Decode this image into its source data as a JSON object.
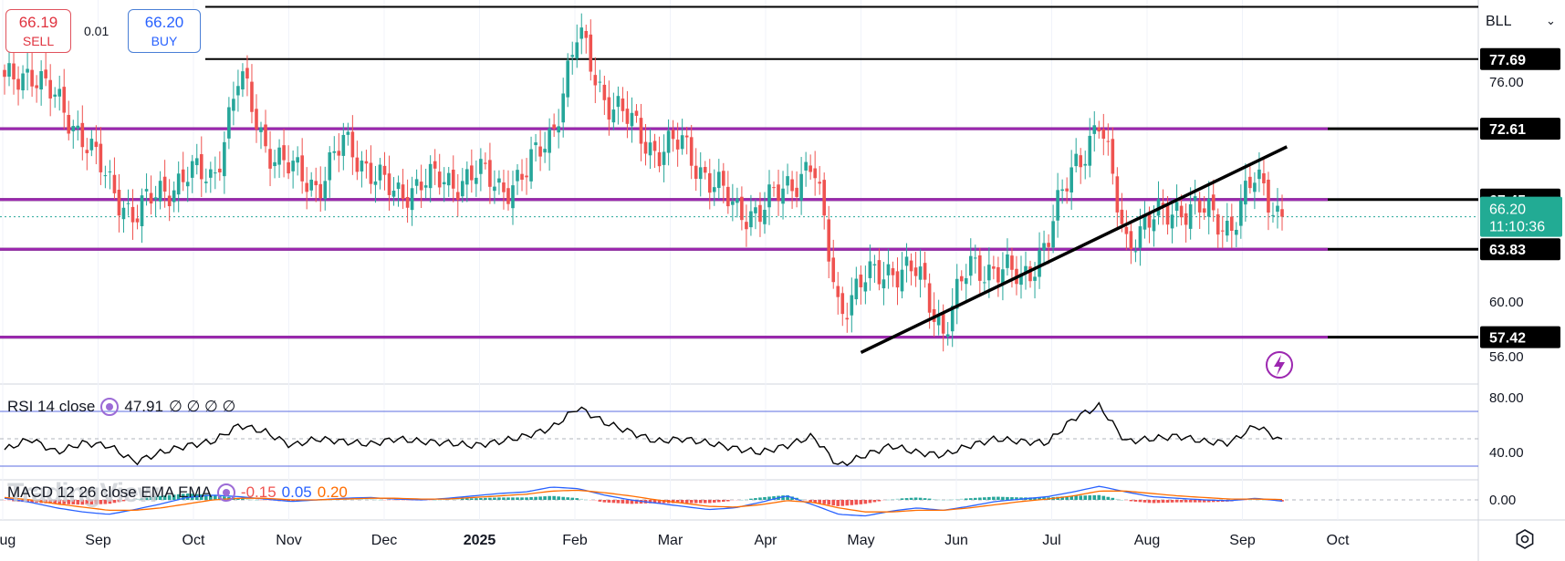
{
  "symbol": "BLL",
  "trade": {
    "sell_price": "66.19",
    "sell_label": "SELL",
    "buy_price": "66.20",
    "buy_label": "BUY",
    "spread": "0.01"
  },
  "icons": [
    "chevron-down-icon",
    "indicator-settings-icon",
    "lightning-icon",
    "settings-icon"
  ],
  "colors": {
    "up": "#26a69a",
    "down": "#ef5350",
    "purple": "#9c27b0",
    "rsi": "#000000",
    "rsi_band": "#5b6ee1",
    "macd": "#2962ff",
    "signal": "#ff6d00"
  },
  "watermark": "TradingView",
  "chart_data": [
    {
      "type": "candlestick",
      "ylim": [
        54.0,
        82.0
      ],
      "price_ticks": [
        "76.00",
        "60.00",
        "56.00"
      ],
      "x_ticks": [
        "Aug",
        "Sep",
        "Oct",
        "Nov",
        "Dec",
        "2025",
        "Feb",
        "Mar",
        "Apr",
        "May",
        "Jun",
        "Jul",
        "Aug",
        "Sep",
        "Oct"
      ],
      "horizontal_levels": [
        {
          "label": "",
          "value": 81.5,
          "color": "#000000"
        },
        {
          "label": "77.69",
          "value": 77.69,
          "color": "#000000"
        },
        {
          "label": "72.61",
          "value": 72.61,
          "color": "#9c27b0"
        },
        {
          "label": "67.45",
          "value": 67.45,
          "color": "#9c27b0"
        },
        {
          "label": "63.83",
          "value": 63.83,
          "color": "#9c27b0"
        },
        {
          "label": "57.42",
          "value": 57.42,
          "color": "#9c27b0"
        }
      ],
      "trendline": {
        "from": [
          "2025-05-01",
          56.3
        ],
        "to": [
          "2025-09-15",
          71.3
        ]
      },
      "last_price": "66.20",
      "countdown": "11:10:36",
      "series": [
        {
          "x": "Aug",
          "y": 75.8
        },
        {
          "x": "Aug",
          "y": 77.0
        },
        {
          "x": "Aug",
          "y": 74.5
        },
        {
          "x": "Aug",
          "y": 72.2
        },
        {
          "x": "Sep",
          "y": 68.5
        },
        {
          "x": "Sep",
          "y": 66.3
        },
        {
          "x": "Sep",
          "y": 68.0
        },
        {
          "x": "Sep",
          "y": 69.3
        },
        {
          "x": "Oct",
          "y": 69.0
        },
        {
          "x": "Oct",
          "y": 76.5
        },
        {
          "x": "Oct",
          "y": 71.5
        },
        {
          "x": "Oct",
          "y": 69.5
        },
        {
          "x": "Nov",
          "y": 68.5
        },
        {
          "x": "Nov",
          "y": 71.5
        },
        {
          "x": "Nov",
          "y": 69.8
        },
        {
          "x": "Nov",
          "y": 67.5
        },
        {
          "x": "Dec",
          "y": 69.0
        },
        {
          "x": "Dec",
          "y": 68.5
        },
        {
          "x": "Dec",
          "y": 69.5
        },
        {
          "x": "Dec",
          "y": 68.3
        },
        {
          "x": "2025",
          "y": 69.3
        },
        {
          "x": "2025",
          "y": 72.5
        },
        {
          "x": "2025",
          "y": 79.5
        },
        {
          "x": "2025",
          "y": 75.0
        },
        {
          "x": "Feb",
          "y": 73.0
        },
        {
          "x": "Feb",
          "y": 71.0
        },
        {
          "x": "Feb",
          "y": 71.5
        },
        {
          "x": "Feb",
          "y": 69.0
        },
        {
          "x": "Mar",
          "y": 66.8
        },
        {
          "x": "Mar",
          "y": 66.5
        },
        {
          "x": "Mar",
          "y": 68.5
        },
        {
          "x": "Mar",
          "y": 70.0
        },
        {
          "x": "Apr",
          "y": 59.5
        },
        {
          "x": "Apr",
          "y": 61.5
        },
        {
          "x": "Apr",
          "y": 62.5
        },
        {
          "x": "Apr",
          "y": 62.0
        },
        {
          "x": "May",
          "y": 58.0
        },
        {
          "x": "May",
          "y": 62.5
        },
        {
          "x": "May",
          "y": 62.5
        },
        {
          "x": "May",
          "y": 61.5
        },
        {
          "x": "Jun",
          "y": 64.5
        },
        {
          "x": "Jun",
          "y": 70.0
        },
        {
          "x": "Jun",
          "y": 73.0
        },
        {
          "x": "Jun",
          "y": 64.5
        },
        {
          "x": "Jul",
          "y": 65.8
        },
        {
          "x": "Jul",
          "y": 67.0
        },
        {
          "x": "Jul",
          "y": 66.5
        },
        {
          "x": "Jul",
          "y": 65.5
        },
        {
          "x": "Aug",
          "y": 69.0
        },
        {
          "x": "Aug",
          "y": 66.2
        }
      ]
    },
    {
      "type": "line",
      "name": "RSI 14 close",
      "value": "47.91",
      "extra": "∅ ∅ ∅ ∅",
      "ylim": [
        20,
        90
      ],
      "ticks": [
        "80.00",
        "40.00"
      ],
      "bands": [
        70,
        30
      ],
      "midline": 50,
      "values": [
        42,
        50,
        40,
        47,
        45,
        33,
        40,
        45,
        48,
        60,
        55,
        45,
        50,
        48,
        46,
        50,
        48,
        47,
        45,
        48,
        52,
        58,
        73,
        62,
        55,
        48,
        50,
        47,
        43,
        40,
        45,
        52,
        30,
        38,
        45,
        40,
        38,
        45,
        50,
        48,
        47,
        65,
        74,
        48,
        50,
        52,
        48,
        47,
        60,
        48
      ]
    },
    {
      "type": "bar",
      "name": "MACD 12 26 close EMA EMA",
      "values_label": [
        "-0.15",
        "0.05",
        "0.20"
      ],
      "ylim": [
        -2.5,
        2.5
      ],
      "ticks": [
        "0.00"
      ],
      "macd": [
        0.2,
        -0.3,
        -1.0,
        -1.5,
        -1.8,
        -1.2,
        -0.5,
        0.3,
        0.6,
        0.4,
        0.1,
        -0.2,
        0.0,
        0.2,
        0.3,
        0.1,
        0.0,
        0.2,
        0.5,
        0.8,
        1.0,
        1.6,
        1.4,
        0.6,
        0.0,
        -0.4,
        -0.8,
        -1.2,
        -1.0,
        -0.3,
        0.5,
        -0.6,
        -1.8,
        -2.0,
        -1.4,
        -1.0,
        -1.3,
        -0.8,
        -0.2,
        0.1,
        0.4,
        1.0,
        1.7,
        1.0,
        0.4,
        0.2,
        0.0,
        -0.1,
        0.2,
        -0.15
      ],
      "signal": [
        0.3,
        0.0,
        -0.5,
        -0.9,
        -1.3,
        -1.3,
        -1.0,
        -0.5,
        0.0,
        0.2,
        0.2,
        0.0,
        0.0,
        0.1,
        0.2,
        0.2,
        0.1,
        0.1,
        0.3,
        0.5,
        0.7,
        1.1,
        1.2,
        0.9,
        0.5,
        0.0,
        -0.4,
        -0.8,
        -0.9,
        -0.6,
        -0.1,
        -0.3,
        -1.0,
        -1.5,
        -1.5,
        -1.3,
        -1.3,
        -1.0,
        -0.6,
        -0.2,
        0.1,
        0.5,
        1.1,
        1.1,
        0.8,
        0.5,
        0.3,
        0.1,
        0.1,
        0.05
      ]
    }
  ]
}
